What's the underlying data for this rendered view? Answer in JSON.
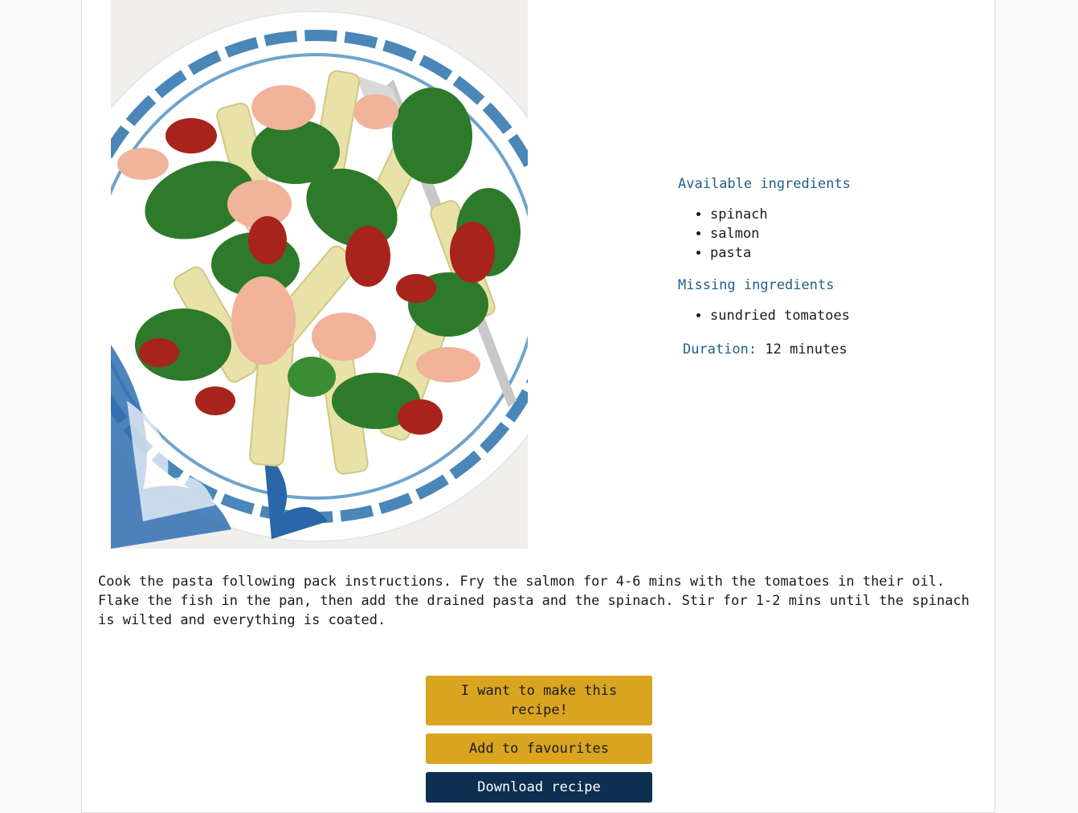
{
  "recipe": {
    "image_alt": "Salmon, spinach and sundried tomato pasta",
    "available_heading": "Available ingredients",
    "available": [
      "spinach",
      "salmon",
      "pasta"
    ],
    "missing_heading": "Missing ingredients",
    "missing": [
      "sundried tomatoes"
    ],
    "duration_label": "Duration:",
    "duration_value": "12 minutes",
    "instructions": "Cook the pasta following pack instructions. Fry the salmon for 4-6 mins with the tomatoes in their oil. Flake the fish in the pan, then add the drained pasta and the spinach. Stir for 1-2 mins until the spinach is wilted and everything is coated."
  },
  "actions": {
    "make_label": "I want to make this recipe!",
    "favourite_label": "Add to favourites",
    "download_label": "Download recipe"
  },
  "colors": {
    "heading": "#1f5f8b",
    "gold_button": "#d9a520",
    "navy_button": "#0c2f52"
  }
}
